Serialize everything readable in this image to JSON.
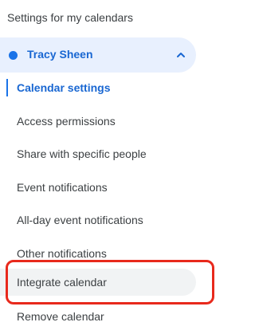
{
  "sidebar": {
    "section_title": "Settings for my calendars",
    "calendar": {
      "name": "Tracy Sheen",
      "color": "#1a73e8",
      "expanded": true
    },
    "items": [
      {
        "label": "Calendar settings",
        "active": true
      },
      {
        "label": "Access permissions",
        "active": false
      },
      {
        "label": "Share with specific people",
        "active": false
      },
      {
        "label": "Event notifications",
        "active": false
      },
      {
        "label": "All-day event notifications",
        "active": false
      },
      {
        "label": "Other notifications",
        "active": false
      },
      {
        "label": "Integrate calendar",
        "active": false,
        "hovered": true
      },
      {
        "label": "Remove calendar",
        "active": false
      }
    ]
  },
  "annotation": {
    "highlight_color": "#e8291c"
  }
}
